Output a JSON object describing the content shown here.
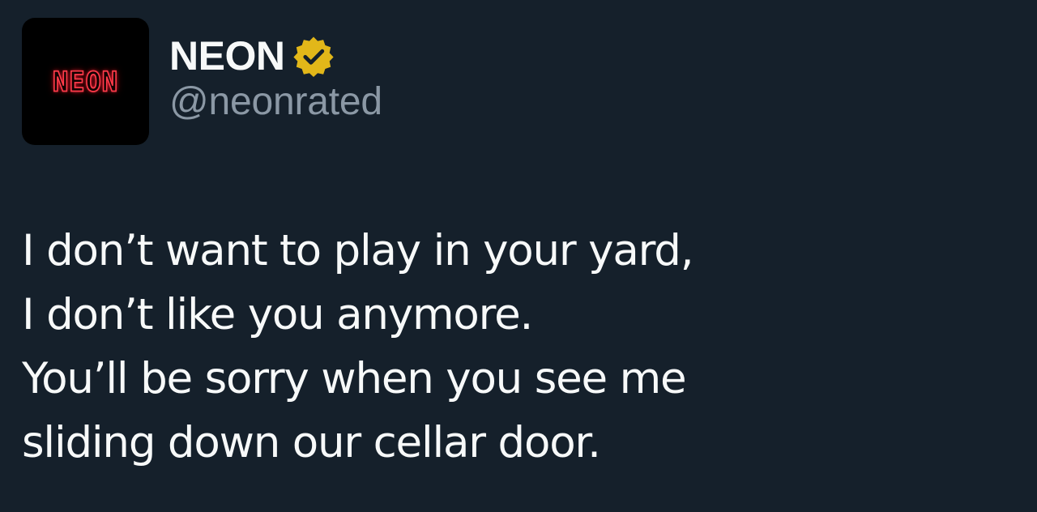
{
  "author": {
    "avatar_text": "NEON",
    "display_name": "NEON",
    "handle": "@neonrated",
    "verified_badge_icon": "verified-gold-check-icon"
  },
  "tweet": {
    "lines": [
      "I don’t want to play in your yard,",
      "I don’t like you anymore.",
      "You’ll be sorry when you see me",
      "sliding down our cellar door."
    ]
  },
  "colors": {
    "background": "#15202b",
    "primary_text": "#f7f9f9",
    "secondary_text": "#8b98a5",
    "verified_badge": "#e2b719",
    "avatar_background": "#000000",
    "neon_red": "#ff3b4a"
  }
}
